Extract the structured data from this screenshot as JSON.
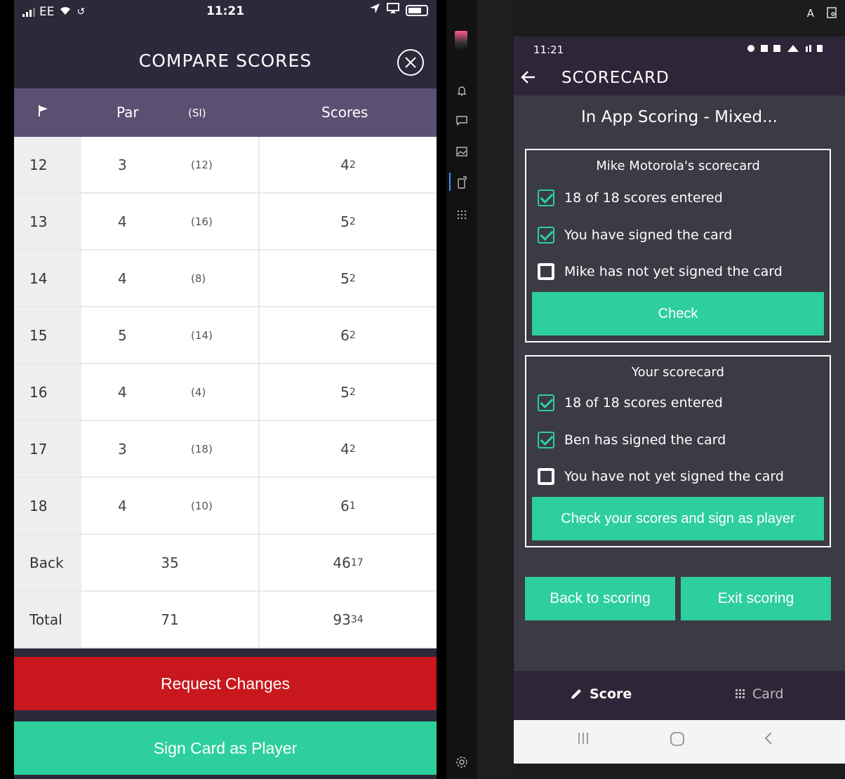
{
  "ios": {
    "status": {
      "carrier": "EE",
      "time": "11:21"
    },
    "title": "COMPARE SCORES",
    "columns": {
      "par": "Par",
      "si": "(SI)",
      "scores": "Scores"
    },
    "holes": [
      {
        "hole": "12",
        "par": "3",
        "si": "(12)",
        "score": "4",
        "points": "2"
      },
      {
        "hole": "13",
        "par": "4",
        "si": "(16)",
        "score": "5",
        "points": "2"
      },
      {
        "hole": "14",
        "par": "4",
        "si": "(8)",
        "score": "5",
        "points": "2"
      },
      {
        "hole": "15",
        "par": "5",
        "si": "(14)",
        "score": "6",
        "points": "2"
      },
      {
        "hole": "16",
        "par": "4",
        "si": "(4)",
        "score": "5",
        "points": "2"
      },
      {
        "hole": "17",
        "par": "3",
        "si": "(18)",
        "score": "4",
        "points": "2"
      },
      {
        "hole": "18",
        "par": "4",
        "si": "(10)",
        "score": "6",
        "points": "1"
      }
    ],
    "back": {
      "label": "Back",
      "par": "35",
      "score": "46",
      "points": "17"
    },
    "total": {
      "label": "Total",
      "par": "71",
      "score": "93",
      "points": "34"
    },
    "request_changes": "Request Changes",
    "sign_card": "Sign Card as Player"
  },
  "android": {
    "status_time": "11:21",
    "appbar_title": "SCORECARD",
    "subtitle": "In App Scoring - Mixed...",
    "card1": {
      "title": "Mike Motorola's scorecard",
      "line1": "18 of 18 scores entered",
      "line2": "You have signed the card",
      "line3": "Mike has not yet signed the card",
      "action": "Check"
    },
    "card2": {
      "title": "Your scorecard",
      "line1": "18 of 18 scores entered",
      "line2": "Ben has signed the card",
      "line3": "You have not yet signed the card",
      "action": "Check your scores and sign as player"
    },
    "back_to_scoring": "Back to scoring",
    "exit_scoring": "Exit scoring",
    "tab_score": "Score",
    "tab_card": "Card"
  },
  "colors": {
    "header_purple": "#2b2a3a",
    "table_head": "#5a5172",
    "green": "#2dcf9c",
    "red": "#c8171d",
    "android_content": "#3b3b45"
  }
}
